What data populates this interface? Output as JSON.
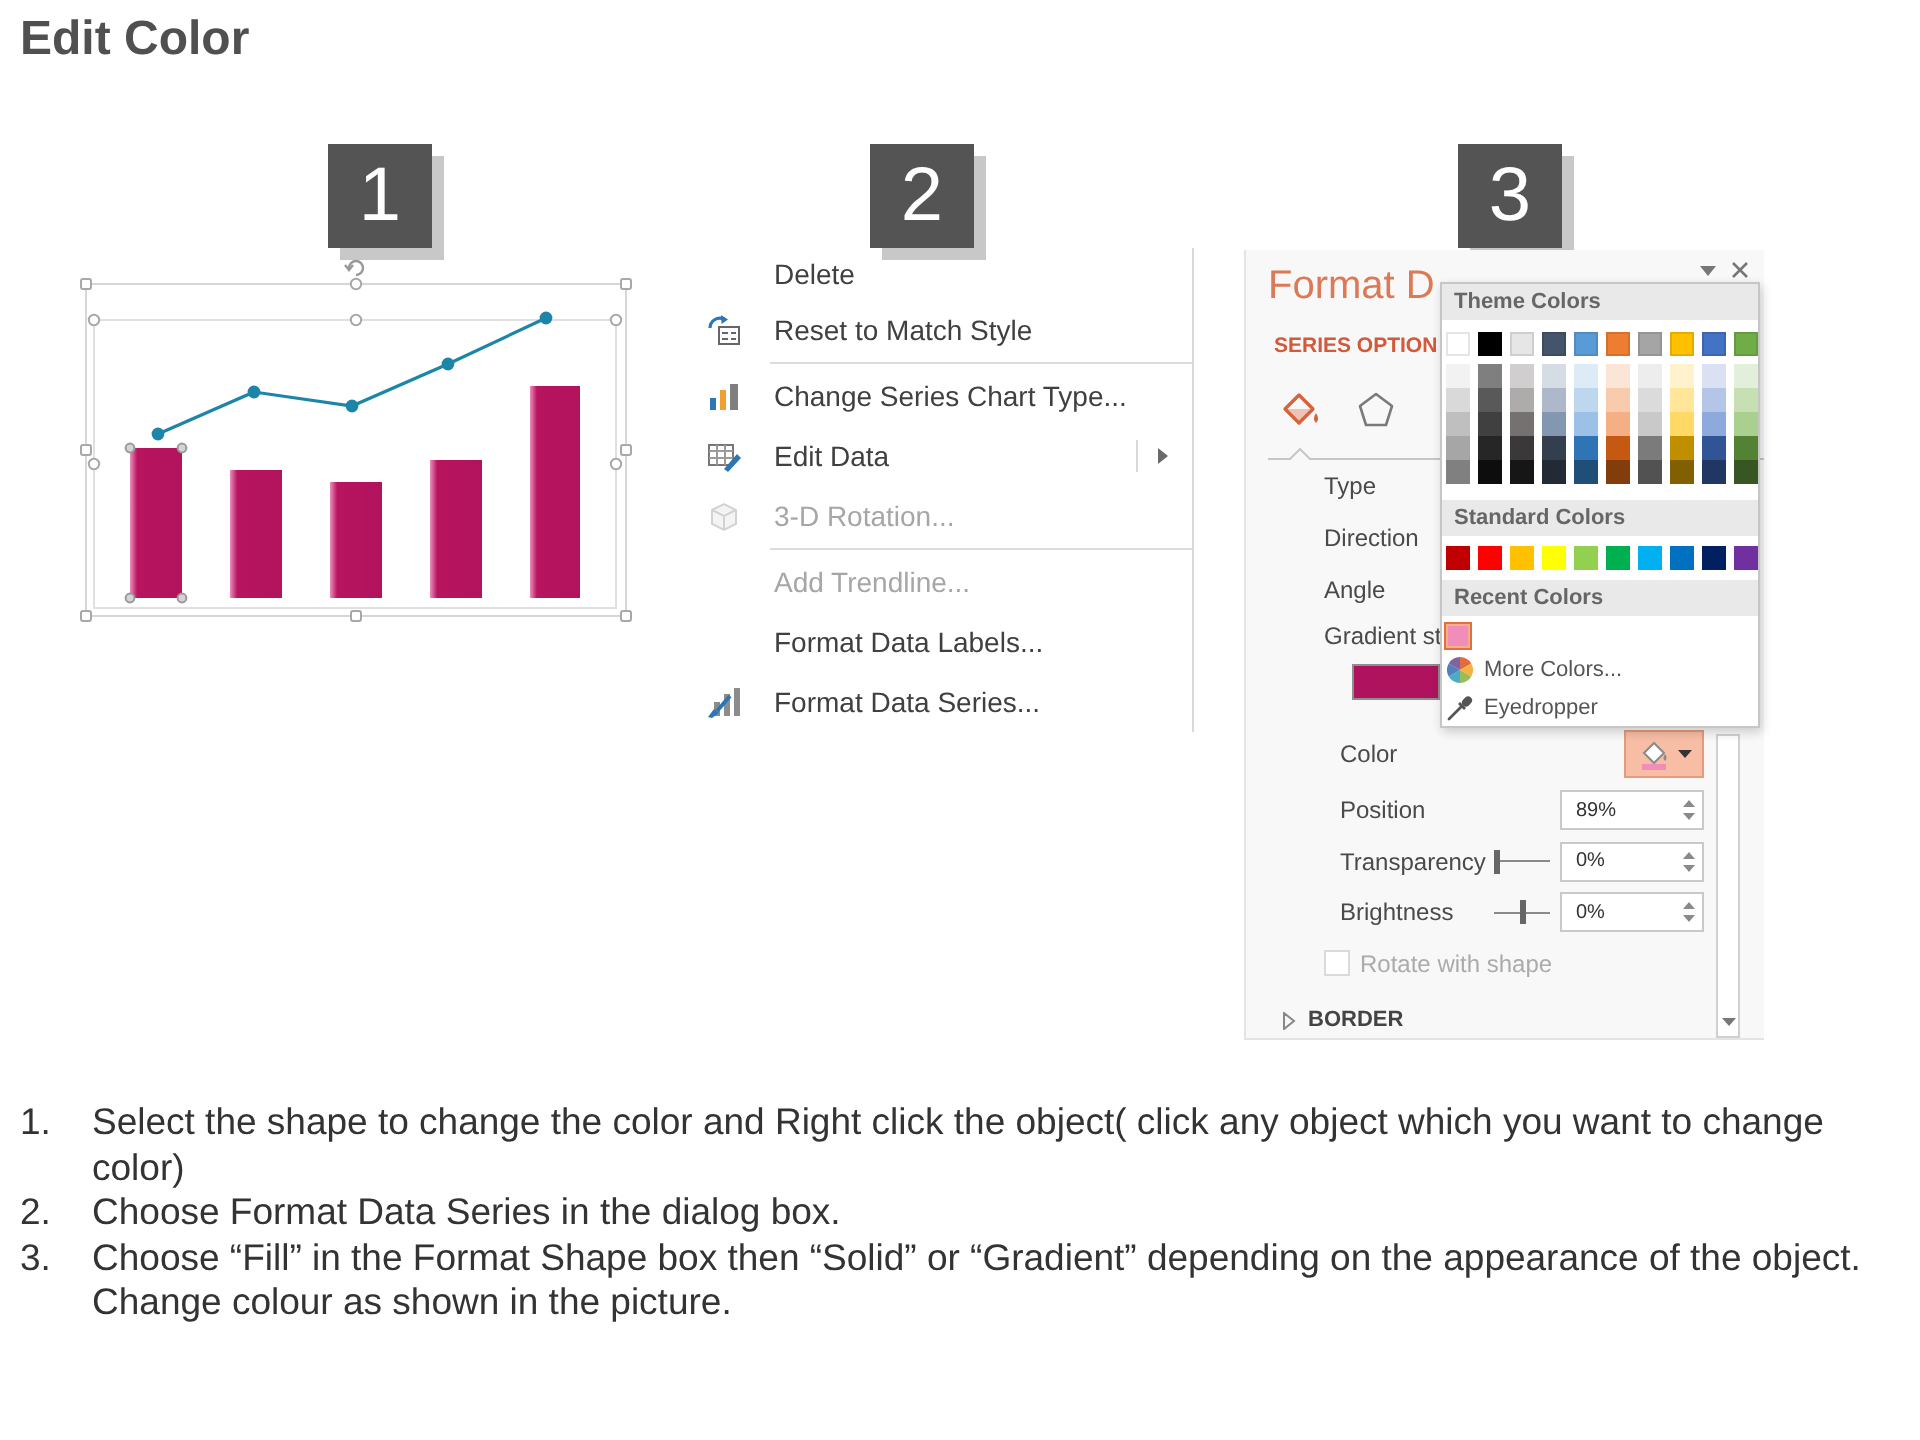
{
  "title": "Edit Color",
  "step_badges": [
    {
      "number": "1"
    },
    {
      "number": "2"
    },
    {
      "number": "3"
    }
  ],
  "context_menu": {
    "items": [
      {
        "label": "Delete",
        "disabled": false,
        "submenu": false,
        "separator_after": false
      },
      {
        "label": "Reset to Match Style",
        "disabled": false,
        "submenu": false,
        "separator_after": true
      },
      {
        "label": "Change Series Chart Type...",
        "disabled": false,
        "submenu": false,
        "separator_after": false
      },
      {
        "label": "Edit Data",
        "disabled": false,
        "submenu": true,
        "separator_after": false
      },
      {
        "label": "3-D Rotation...",
        "disabled": true,
        "submenu": false,
        "separator_after": true
      },
      {
        "label": "Add Trendline...",
        "disabled": true,
        "submenu": false,
        "separator_after": false
      },
      {
        "label": "Format Data Labels...",
        "disabled": false,
        "submenu": false,
        "separator_after": false
      },
      {
        "label": "Format Data Series...",
        "disabled": false,
        "submenu": false,
        "separator_after": false
      }
    ]
  },
  "format_pane": {
    "title": "Format D",
    "tab_label": "SERIES OPTION",
    "icon_tabs": [
      {
        "selected": true
      },
      {
        "selected": false
      }
    ],
    "rows": [
      {
        "kind": "label",
        "label": "Type"
      },
      {
        "kind": "label",
        "label": "Direction"
      },
      {
        "kind": "label",
        "label": "Angle"
      },
      {
        "kind": "gradient",
        "label": "Gradient st"
      }
    ],
    "stop_rows": [
      {
        "kind": "color",
        "label": "Color"
      },
      {
        "kind": "spin",
        "label": "Position",
        "value": "89%"
      },
      {
        "kind": "slider",
        "label": "Transparency",
        "level": 0,
        "value": "0%"
      },
      {
        "kind": "slider",
        "label": "Brightness",
        "level": 0.5,
        "value": "0%"
      },
      {
        "kind": "checkbox",
        "label": "Rotate with shape",
        "checked": false,
        "disabled": true
      }
    ],
    "section": {
      "label": "BORDER",
      "expanded": false
    }
  },
  "color_picker": {
    "sections": [
      {
        "kind": "theme",
        "header": "Theme Colors",
        "columns": [
          {
            "color": "#ffffff",
            "selected": false,
            "shades": [
              {
                "color": "#f2f2f2",
                "selected": false
              },
              {
                "color": "#d9d9d9",
                "selected": false
              },
              {
                "color": "#bfbfbf",
                "selected": false
              },
              {
                "color": "#a6a6a6",
                "selected": false
              },
              {
                "color": "#808080",
                "selected": false
              }
            ]
          },
          {
            "color": "#000000",
            "selected": false,
            "shades": [
              {
                "color": "#7f7f7f",
                "selected": false
              },
              {
                "color": "#595959",
                "selected": false
              },
              {
                "color": "#404040",
                "selected": false
              },
              {
                "color": "#262626",
                "selected": false
              },
              {
                "color": "#0d0d0d",
                "selected": false
              }
            ]
          },
          {
            "color": "#e7e6e6",
            "selected": false,
            "shades": [
              {
                "color": "#d0cece",
                "selected": false
              },
              {
                "color": "#aeabab",
                "selected": false
              },
              {
                "color": "#757171",
                "selected": false
              },
              {
                "color": "#3a3838",
                "selected": false
              },
              {
                "color": "#171616",
                "selected": false
              }
            ]
          },
          {
            "color": "#44546a",
            "selected": false,
            "shades": [
              {
                "color": "#d6dce4",
                "selected": false
              },
              {
                "color": "#adb9ca",
                "selected": false
              },
              {
                "color": "#8497b0",
                "selected": false
              },
              {
                "color": "#333f4f",
                "selected": false
              },
              {
                "color": "#222a35",
                "selected": false
              }
            ]
          },
          {
            "color": "#5b9bd5",
            "selected": false,
            "shades": [
              {
                "color": "#ddebf7",
                "selected": false
              },
              {
                "color": "#bdd7ee",
                "selected": false
              },
              {
                "color": "#9bc2e6",
                "selected": false
              },
              {
                "color": "#2f75b5",
                "selected": false
              },
              {
                "color": "#1f4e78",
                "selected": false
              }
            ]
          },
          {
            "color": "#ed7d31",
            "selected": false,
            "shades": [
              {
                "color": "#fce4d6",
                "selected": false
              },
              {
                "color": "#f8cbad",
                "selected": false
              },
              {
                "color": "#f4b084",
                "selected": false
              },
              {
                "color": "#c65911",
                "selected": false
              },
              {
                "color": "#833c0c",
                "selected": false
              }
            ]
          },
          {
            "color": "#a5a5a5",
            "selected": false,
            "shades": [
              {
                "color": "#ededed",
                "selected": false
              },
              {
                "color": "#dbdbdb",
                "selected": false
              },
              {
                "color": "#c9c9c9",
                "selected": false
              },
              {
                "color": "#7b7b7b",
                "selected": false
              },
              {
                "color": "#525252",
                "selected": false
              }
            ]
          },
          {
            "color": "#ffc000",
            "selected": false,
            "shades": [
              {
                "color": "#fff2cc",
                "selected": false
              },
              {
                "color": "#ffe699",
                "selected": false
              },
              {
                "color": "#ffd966",
                "selected": false
              },
              {
                "color": "#bf8f00",
                "selected": false
              },
              {
                "color": "#806000",
                "selected": false
              }
            ]
          },
          {
            "color": "#4472c4",
            "selected": false,
            "shades": [
              {
                "color": "#d9e1f2",
                "selected": false
              },
              {
                "color": "#b4c6e7",
                "selected": false
              },
              {
                "color": "#8ea9db",
                "selected": false
              },
              {
                "color": "#305496",
                "selected": false
              },
              {
                "color": "#203764",
                "selected": false
              }
            ]
          },
          {
            "color": "#70ad47",
            "selected": false,
            "shades": [
              {
                "color": "#e2efda",
                "selected": false
              },
              {
                "color": "#c6e0b4",
                "selected": false
              },
              {
                "color": "#a9d08e",
                "selected": false
              },
              {
                "color": "#548235",
                "selected": false
              },
              {
                "color": "#375623",
                "selected": false
              }
            ]
          }
        ]
      },
      {
        "kind": "standard",
        "header": "Standard Colors",
        "colors": [
          {
            "color": "#c00000",
            "selected": false
          },
          {
            "color": "#ff0000",
            "selected": false
          },
          {
            "color": "#ffc000",
            "selected": false
          },
          {
            "color": "#ffff00",
            "selected": false
          },
          {
            "color": "#92d050",
            "selected": false
          },
          {
            "color": "#00b050",
            "selected": false
          },
          {
            "color": "#00b0f0",
            "selected": false
          },
          {
            "color": "#0070c0",
            "selected": false
          },
          {
            "color": "#002060",
            "selected": false
          },
          {
            "color": "#7030a0",
            "selected": false
          }
        ]
      },
      {
        "kind": "recent",
        "header": "Recent Colors",
        "colors": [
          {
            "color": "#f28cb8",
            "selected": true
          }
        ]
      }
    ],
    "actions": [
      {
        "label": "More Colors..."
      },
      {
        "label": "Eyedropper"
      }
    ]
  },
  "instructions": [
    {
      "number": "1.",
      "text": "Select the shape to change the color and Right click the object( click any object which you want to change color)"
    },
    {
      "number": "2.",
      "text": "Choose Format Data Series in the dialog box."
    },
    {
      "number": "3.",
      "text": "Choose “Fill” in the Format Shape box then “Solid” or “Gradient” depending on the appearance of the object. Change colour as shown in the picture."
    }
  ]
}
